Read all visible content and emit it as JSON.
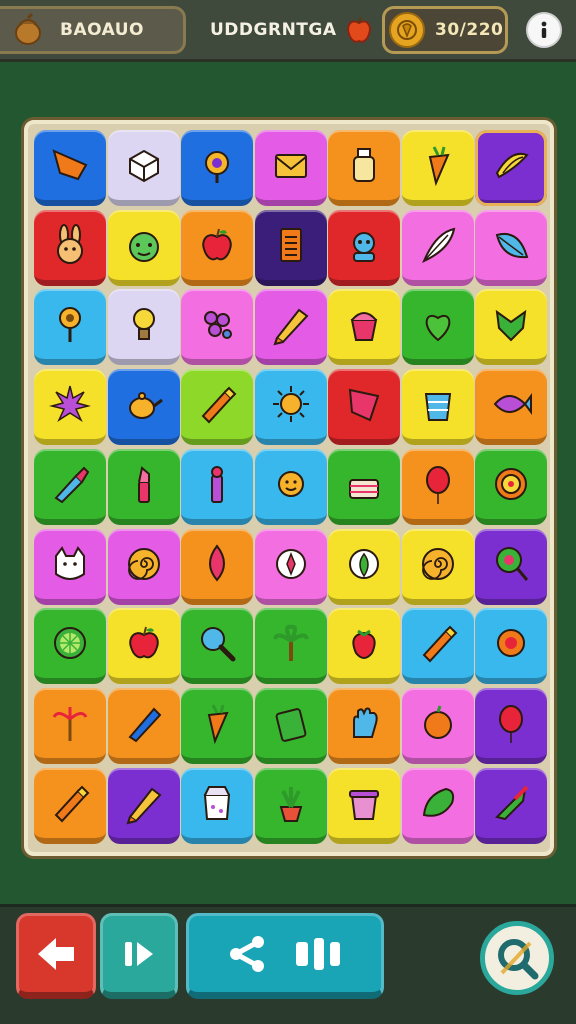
{
  "header": {
    "left_label": "BAOAUO",
    "center_label": "UDDGRNTGA",
    "coin_count": "30/220",
    "left_icon": "nut-icon",
    "center_icon": "apple-icon",
    "coin_icon": "coin-icon",
    "info_icon": "info-icon"
  },
  "colors": {
    "blue": "#1f6fe0",
    "lavender": "#dcd6f2",
    "magenta": "#e45be6",
    "orange": "#f5921e",
    "yellow": "#f6e12a",
    "purple": "#7b2fd0",
    "red": "#e0282a",
    "pink": "#f36fe1",
    "cyan": "#38b8ec",
    "green": "#36b62d",
    "lime": "#8ed82a",
    "navy": "#3a1e7a",
    "teal": "#1fb3c4"
  },
  "board": {
    "rows": [
      [
        {
          "color": "blue",
          "icon": "triangle-flag-icon"
        },
        {
          "color": "lavender",
          "icon": "box-icon"
        },
        {
          "color": "blue",
          "icon": "amulet-icon"
        },
        {
          "color": "magenta",
          "icon": "envelope-icon"
        },
        {
          "color": "orange",
          "icon": "bottle-icon"
        },
        {
          "color": "yellow",
          "icon": "carrot-icon"
        },
        {
          "color": "purple",
          "icon": "banana-icon",
          "selected": true
        }
      ],
      [
        {
          "color": "red",
          "icon": "rabbit-icon"
        },
        {
          "color": "yellow",
          "icon": "frog-icon"
        },
        {
          "color": "orange",
          "icon": "apple-icon"
        },
        {
          "color": "navy",
          "icon": "card-icon"
        },
        {
          "color": "red",
          "icon": "robot-icon"
        },
        {
          "color": "pink",
          "icon": "feather-icon"
        },
        {
          "color": "pink",
          "icon": "leaf-icon"
        }
      ],
      [
        {
          "color": "cyan",
          "icon": "sunflower-icon"
        },
        {
          "color": "lavender",
          "icon": "bulb-icon"
        },
        {
          "color": "pink",
          "icon": "flower-icon"
        },
        {
          "color": "magenta",
          "icon": "pencil-icon"
        },
        {
          "color": "yellow",
          "icon": "cupcake-icon"
        },
        {
          "color": "green",
          "icon": "heart-leaf-icon"
        },
        {
          "color": "yellow",
          "icon": "shield-leaf-icon"
        }
      ],
      [
        {
          "color": "yellow",
          "icon": "starburst-icon"
        },
        {
          "color": "blue",
          "icon": "teapot-icon"
        },
        {
          "color": "lime",
          "icon": "crayon-icon"
        },
        {
          "color": "cyan",
          "icon": "sun-icon"
        },
        {
          "color": "red",
          "icon": "flag-icon"
        },
        {
          "color": "yellow",
          "icon": "cup-icon"
        },
        {
          "color": "orange",
          "icon": "fish-icon"
        }
      ],
      [
        {
          "color": "green",
          "icon": "brush-icon"
        },
        {
          "color": "green",
          "icon": "lipstick-icon"
        },
        {
          "color": "cyan",
          "icon": "marker-icon"
        },
        {
          "color": "cyan",
          "icon": "smiling-sun-icon"
        },
        {
          "color": "green",
          "icon": "cake-icon"
        },
        {
          "color": "orange",
          "icon": "balloon-icon"
        },
        {
          "color": "green",
          "icon": "target-icon"
        }
      ],
      [
        {
          "color": "magenta",
          "icon": "cat-icon"
        },
        {
          "color": "magenta",
          "icon": "spiral-icon"
        },
        {
          "color": "orange",
          "icon": "drop-icon"
        },
        {
          "color": "pink",
          "icon": "compass-icon"
        },
        {
          "color": "yellow",
          "icon": "leaf-badge-icon"
        },
        {
          "color": "yellow",
          "icon": "spiral-icon"
        },
        {
          "color": "purple",
          "icon": "lollipop-icon"
        }
      ],
      [
        {
          "color": "green",
          "icon": "lime-slice-icon"
        },
        {
          "color": "yellow",
          "icon": "apple-icon"
        },
        {
          "color": "green",
          "icon": "magnifier-icon"
        },
        {
          "color": "green",
          "icon": "palm-icon"
        },
        {
          "color": "yellow",
          "icon": "strawberry-icon"
        },
        {
          "color": "cyan",
          "icon": "crayon-icon"
        },
        {
          "color": "cyan",
          "icon": "flower-badge-icon"
        }
      ],
      [
        {
          "color": "orange",
          "icon": "palm-small-icon"
        },
        {
          "color": "orange",
          "icon": "pen-icon"
        },
        {
          "color": "green",
          "icon": "carrot-icon"
        },
        {
          "color": "green",
          "icon": "can-icon"
        },
        {
          "color": "orange",
          "icon": "hand-icon"
        },
        {
          "color": "pink",
          "icon": "orange-fruit-icon"
        },
        {
          "color": "purple",
          "icon": "balloon-icon"
        }
      ],
      [
        {
          "color": "orange",
          "icon": "crayon-icon"
        },
        {
          "color": "purple",
          "icon": "pencil-icon"
        },
        {
          "color": "cyan",
          "icon": "takeout-box-icon"
        },
        {
          "color": "green",
          "icon": "potted-plant-icon"
        },
        {
          "color": "yellow",
          "icon": "pot-icon"
        },
        {
          "color": "pink",
          "icon": "pickle-icon"
        },
        {
          "color": "purple",
          "icon": "rocket-icon"
        }
      ]
    ]
  },
  "footer": {
    "back_icon": "arrow-left-icon",
    "next_icon": "skip-icon",
    "share_icon": "share-icon",
    "pause_icon": "pause-icon",
    "hint_icon": "search-icon",
    "back_color": "#d8372c",
    "next_color": "#2aa89c",
    "share_color": "#1aa5b6",
    "hint_color": "#f3efe0"
  }
}
